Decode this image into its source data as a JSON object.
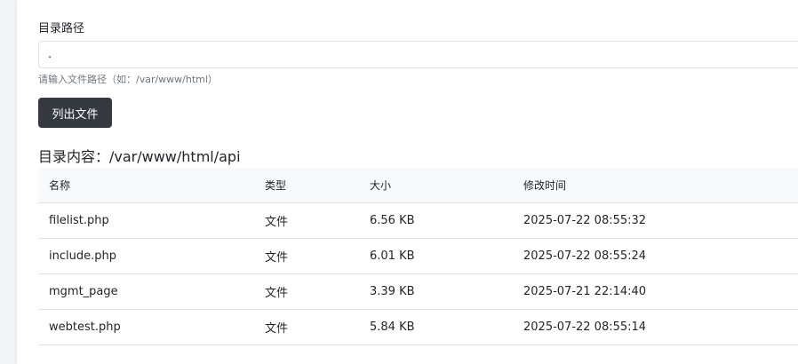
{
  "form": {
    "label": "目录路径",
    "input_value": ".",
    "help": "请输入文件路径（如：/var/www/html）",
    "submit_label": "列出文件"
  },
  "listing": {
    "heading": "目录内容：/var/www/html/api",
    "columns": [
      "名称",
      "类型",
      "大小",
      "修改时间"
    ],
    "rows": [
      [
        "filelist.php",
        "文件",
        "6.56 KB",
        "2025-07-22 08:55:32"
      ],
      [
        "include.php",
        "文件",
        "6.01 KB",
        "2025-07-22 08:55:24"
      ],
      [
        "mgmt_page",
        "文件",
        "3.39 KB",
        "2025-07-21 22:14:40"
      ],
      [
        "webtest.php",
        "文件",
        "5.84 KB",
        "2025-07-22 08:55:14"
      ]
    ]
  },
  "colors": {
    "button_bg": "#343a40",
    "table_header_bg": "#f8f9fa",
    "border": "#dee2e6",
    "help_text": "#6c757d"
  }
}
